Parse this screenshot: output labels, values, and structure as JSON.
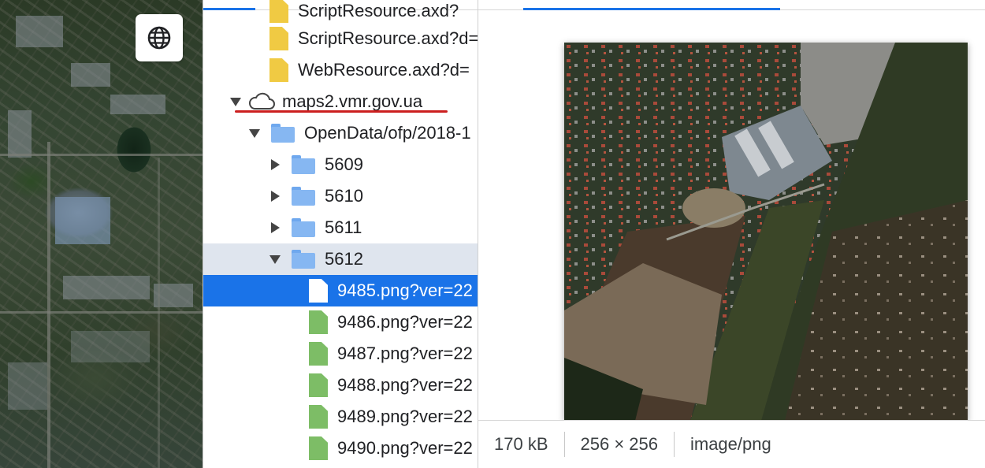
{
  "map": {
    "globe_button_icon": "globe-icon"
  },
  "tree": {
    "rows": [
      {
        "kind": "file",
        "color": "yellow",
        "label": "ScriptResource.axd?"
      },
      {
        "kind": "file",
        "color": "yellow",
        "label": "ScriptResource.axd?d="
      },
      {
        "kind": "file",
        "color": "yellow",
        "label": "WebResource.axd?d="
      },
      {
        "kind": "domain",
        "label": "maps2.vmr.gov.ua"
      },
      {
        "kind": "folder",
        "label": "OpenData/ofp/2018-1"
      },
      {
        "kind": "folder",
        "label": "5609"
      },
      {
        "kind": "folder",
        "label": "5610"
      },
      {
        "kind": "folder",
        "label": "5611"
      },
      {
        "kind": "folder",
        "label": "5612"
      },
      {
        "kind": "file",
        "color": "white",
        "label": "9485.png?ver=22"
      },
      {
        "kind": "file",
        "color": "green",
        "label": "9486.png?ver=22"
      },
      {
        "kind": "file",
        "color": "green",
        "label": "9487.png?ver=22"
      },
      {
        "kind": "file",
        "color": "green",
        "label": "9488.png?ver=22"
      },
      {
        "kind": "file",
        "color": "green",
        "label": "9489.png?ver=22"
      },
      {
        "kind": "file",
        "color": "green",
        "label": "9490.png?ver=22"
      }
    ],
    "colors": {
      "selected_row": "#1a73e8",
      "expanded_group_row": "#dfe5ee",
      "script_file": "#f0ca43",
      "image_file": "#7dbd66",
      "folder": "#86b7f2",
      "annotation_underline": "#cc1f1f"
    }
  },
  "preview": {
    "image_alt": "Satellite tile preview",
    "status": {
      "size": "170 kB",
      "dimensions": "256 × 256",
      "mime": "image/png"
    }
  }
}
